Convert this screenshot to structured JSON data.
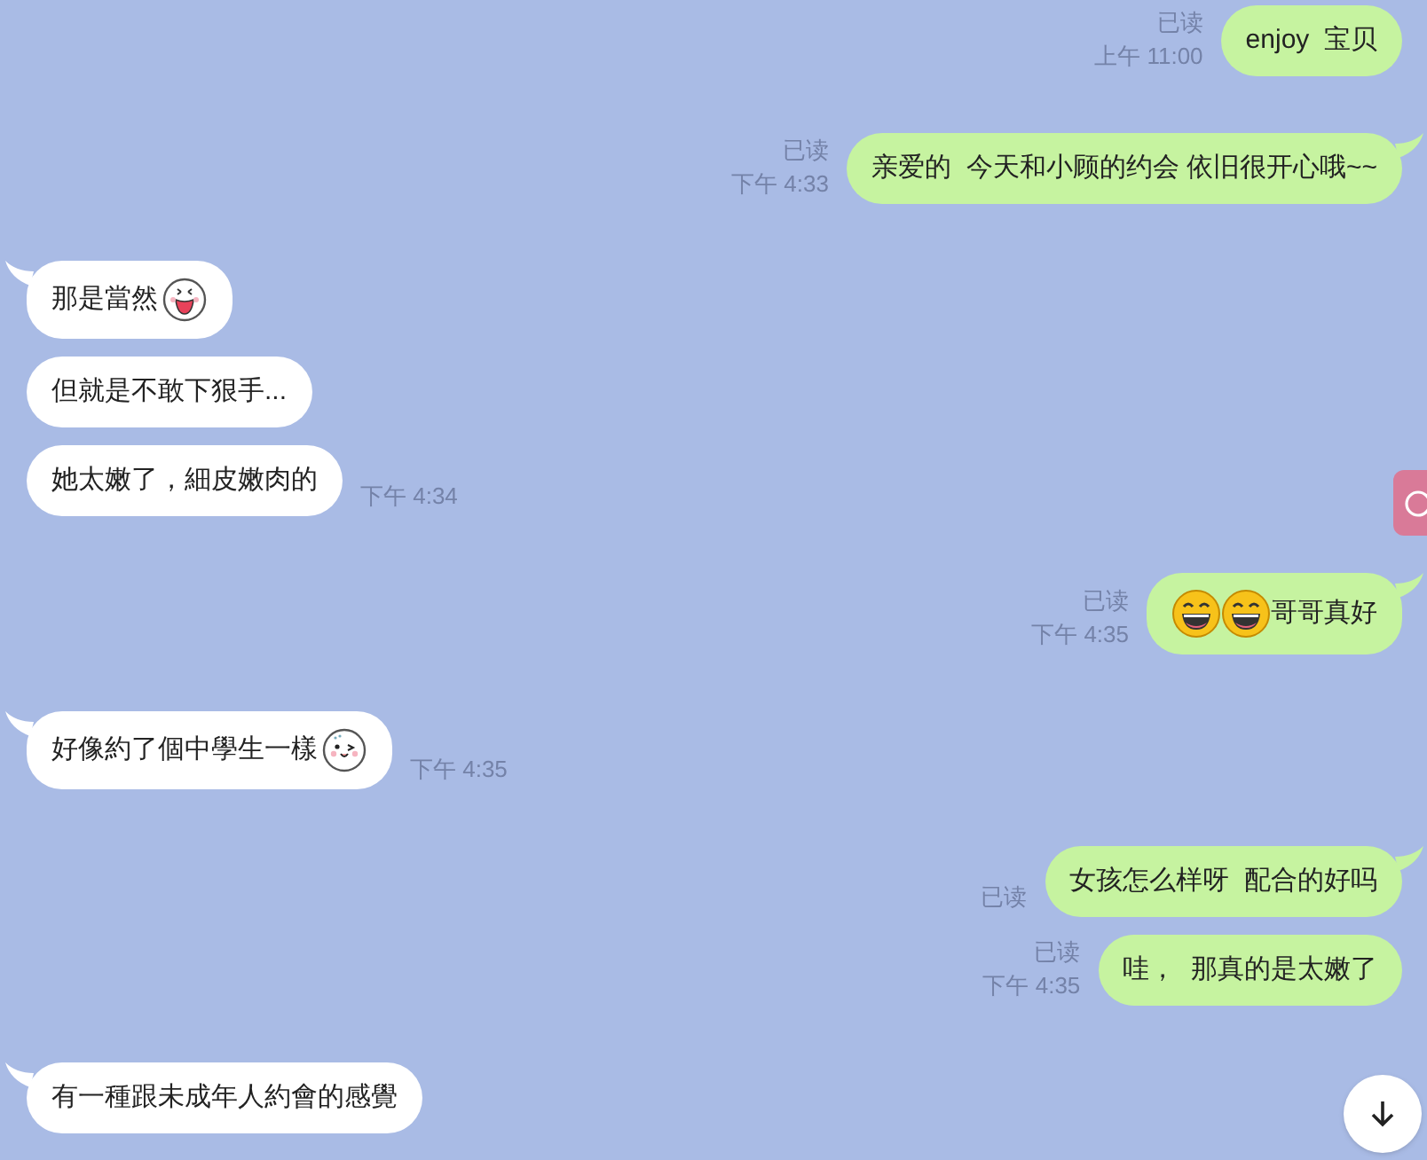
{
  "groups": [
    {
      "kind": "outgoing",
      "messages": [
        {
          "parts": [
            {
              "kind": "text",
              "text": "enjoy  宝贝"
            }
          ],
          "read": "已读",
          "time": "上午 11:00",
          "tail": false
        }
      ]
    },
    {
      "kind": "outgoing",
      "messages": [
        {
          "parts": [
            {
              "kind": "text",
              "text": "亲爱的  今天和小顾的约会 依旧很开心哦~~"
            }
          ],
          "read": "已读",
          "time": "下午 4:33",
          "tail": true
        }
      ]
    },
    {
      "kind": "incoming",
      "messages": [
        {
          "parts": [
            {
              "kind": "text",
              "text": "那是當然"
            },
            {
              "kind": "grin"
            }
          ],
          "tail": true
        },
        {
          "parts": [
            {
              "kind": "text",
              "text": "但就是不敢下狠手..."
            }
          ],
          "tail": false
        },
        {
          "parts": [
            {
              "kind": "text",
              "text": "她太嫩了，細皮嫩肉的"
            }
          ],
          "time": "下午 4:34",
          "tail": false
        }
      ]
    },
    {
      "kind": "outgoing",
      "messages": [
        {
          "parts": [
            {
              "kind": "laugh"
            },
            {
              "kind": "laugh"
            },
            {
              "kind": "text",
              "text": "哥哥真好"
            }
          ],
          "read": "已读",
          "time": "下午 4:35",
          "tail": true
        }
      ]
    },
    {
      "kind": "incoming",
      "messages": [
        {
          "parts": [
            {
              "kind": "text",
              "text": "好像約了個中學生一樣"
            },
            {
              "kind": "wink"
            }
          ],
          "time": "下午 4:35",
          "tail": true
        }
      ]
    },
    {
      "kind": "outgoing",
      "messages": [
        {
          "parts": [
            {
              "kind": "text",
              "text": "女孩怎么样呀  配合的好吗"
            }
          ],
          "read": "已读",
          "tail": true
        },
        {
          "parts": [
            {
              "kind": "text",
              "text": "哇，  那真的是太嫩了"
            }
          ],
          "read": "已读",
          "time": "下午 4:35",
          "tail": false
        }
      ]
    },
    {
      "kind": "incoming",
      "messages": [
        {
          "parts": [
            {
              "kind": "text",
              "text": "有一種跟未成年人約會的感覺"
            }
          ],
          "tail": true
        }
      ]
    }
  ]
}
